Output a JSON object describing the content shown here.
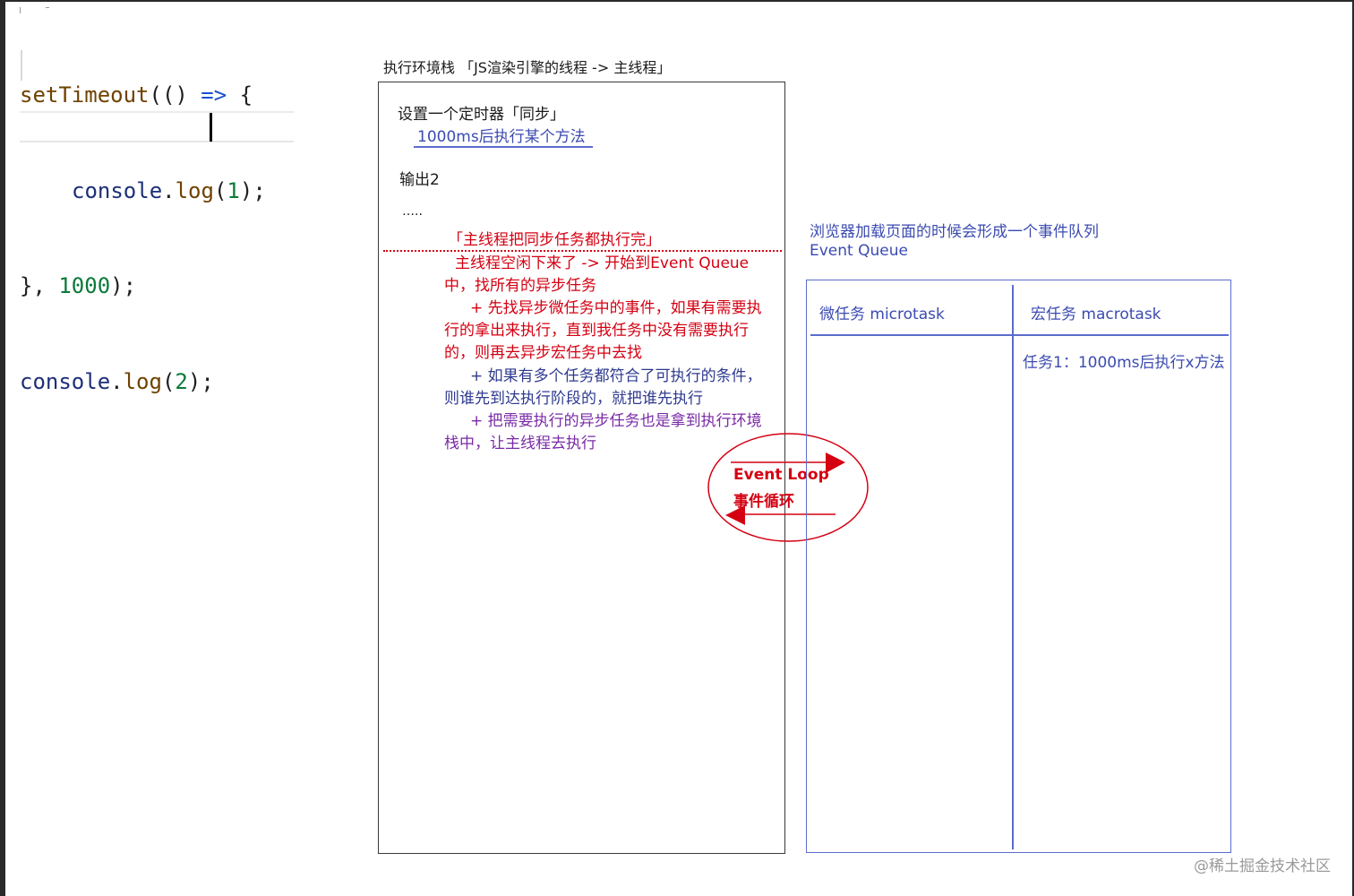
{
  "code": {
    "line1": {
      "fn": "setTimeout",
      "rest": "(() ",
      "arrow": "=>",
      "brace": " {"
    },
    "line2": {
      "obj": "console",
      "dot": ".",
      "method": "log",
      "open": "(",
      "num": "1",
      "close": ");"
    },
    "line3": {
      "pre": "}, ",
      "num": "1000",
      "post": ");"
    },
    "line4": {
      "obj": "console",
      "dot": ".",
      "method": "log",
      "open": "(",
      "num": "2",
      "close": ");"
    }
  },
  "stack": {
    "title": "执行环境栈  「JS渲染引擎的线程 -> 主线程」",
    "item1": "设置一个定时器「同步」",
    "item1_sub": "1000ms后执行某个方法",
    "item2": "输出2",
    "ellipsis": "…..",
    "sync_done": "「主线程把同步任务都执行完」",
    "idle_line1": "主线程空闲下来了 -> 开始到Event Queue",
    "idle_line2": "中，找所有的异步任务",
    "micro_line1": "+ 先找异步微任务中的事件，如果有需要执",
    "micro_line2": "行的拿出来执行，直到我任务中没有需要执行",
    "micro_line3": "的，则再去异步宏任务中去找",
    "multi_line1": "+ 如果有多个任务都符合了可执行的条件，",
    "multi_line2": "则谁先到达执行阶段的，就把谁先执行",
    "push_line1": "+ 把需要执行的异步任务也是拿到执行环境",
    "push_line2": "栈中，让主线程去执行"
  },
  "queue": {
    "desc": "浏览器加载页面的时候会形成一个事件队列",
    "name": " Event Queue",
    "micro_header": "微任务 microtask",
    "macro_header": "宏任务  macrotask",
    "macro_task1": "任务1：1000ms后执行x方法"
  },
  "event_loop": {
    "label_en": "Event Loop",
    "label_cn": "事件循环",
    "color": "#d40012"
  },
  "watermark": "@稀土掘金技术社区",
  "colors": {
    "red": "#d40012",
    "blue": "#3b4bb0",
    "purple": "#7a2aa6",
    "box_border": "#5b6ccc"
  }
}
